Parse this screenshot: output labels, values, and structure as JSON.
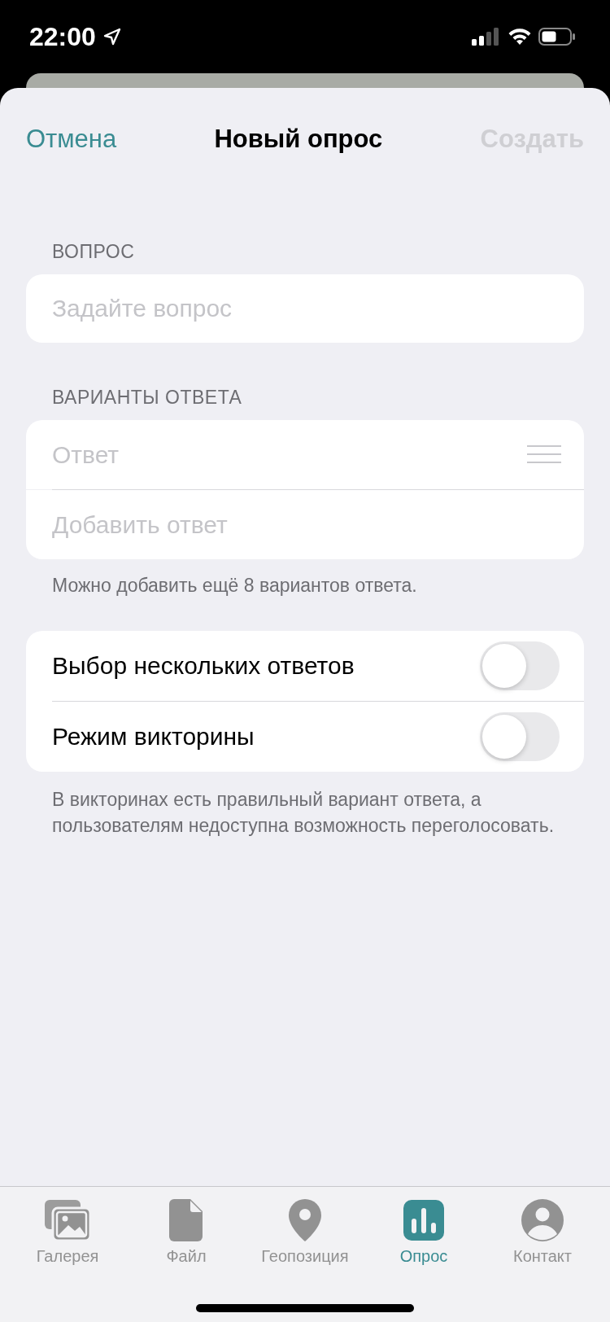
{
  "status_bar": {
    "time": "22:00"
  },
  "nav": {
    "cancel": "Отмена",
    "title": "Новый опрос",
    "create": {
      "label": "Создать",
      "disabled": true
    }
  },
  "question": {
    "header": "ВОПРОС",
    "placeholder": "Задайте вопрос"
  },
  "answers": {
    "header": "ВАРИАНТЫ ОТВЕТА",
    "fields": [
      {
        "placeholder": "Ответ",
        "reorder": true
      },
      {
        "placeholder": "Добавить ответ",
        "reorder": false
      }
    ],
    "hint": "Можно добавить ещё 8 вариантов ответа."
  },
  "options": {
    "toggles": [
      {
        "label": "Выбор нескольких ответов",
        "on": false
      },
      {
        "label": "Режим викторины",
        "on": false
      }
    ],
    "footnote": "В викторинах есть правильный вариант ответа, а пользователям недоступна возможность переголосовать."
  },
  "tabs": [
    {
      "label": "Галерея",
      "kind": "gallery",
      "selected": false
    },
    {
      "label": "Файл",
      "kind": "file",
      "selected": false
    },
    {
      "label": "Геопозиция",
      "kind": "location",
      "selected": false
    },
    {
      "label": "Опрос",
      "kind": "poll",
      "selected": true
    },
    {
      "label": "Контакт",
      "kind": "contact",
      "selected": false
    }
  ]
}
